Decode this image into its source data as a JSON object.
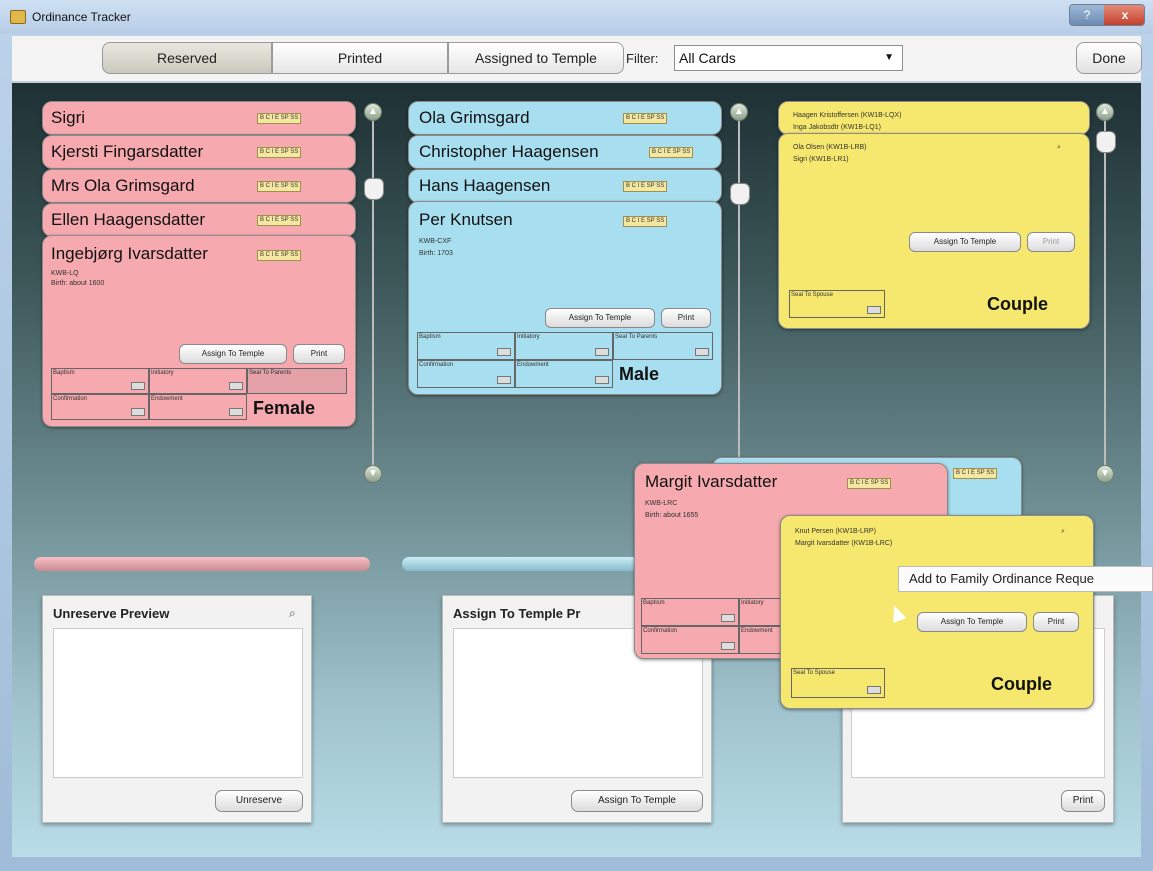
{
  "window": {
    "title": "Ordinance Tracker",
    "controls": [
      "?",
      "x"
    ]
  },
  "toolbar": {
    "tabs": [
      {
        "label": "Reserved",
        "active": true
      },
      {
        "label": "Printed",
        "active": false
      },
      {
        "label": "Assigned to Temple",
        "active": false
      }
    ],
    "filter_label": "Filter:",
    "filter_value": "All Cards",
    "done_label": "Done"
  },
  "ordinance_badge": "B C I E SP SS",
  "labels": {
    "assign_to_temple": "Assign To Temple",
    "print": "Print",
    "baptism": "Baptism",
    "initiatory": "Initiatory",
    "seal_to_parents": "Seal To Parents",
    "confirmation": "Confirmation",
    "endowment": "Endowment",
    "seal_to_spouse": "Seal To Spouse"
  },
  "stack_pink": {
    "names": [
      "Sigri",
      "Kjersti Fingarsdatter",
      "Mrs Ola Grimsgard",
      "Ellen Haagensdatter",
      "Ingebjørg Ivarsdatter"
    ],
    "id": "KWB-LQ",
    "birth": "Birth: about 1600",
    "gender": "Female"
  },
  "stack_blue": {
    "names": [
      "Ola Grimsgard",
      "Christopher Haagensen",
      "Hans Haagensen",
      "Per Knutsen"
    ],
    "id": "KWB-CXF",
    "birth": "Birth: 1703",
    "gender": "Male"
  },
  "stack_yellow": {
    "back_line1": "Haagen Kristoffersen (KW1B-LQX)",
    "back_line2": "Inga Jakobsdtr (KW1B-LQ1)",
    "line1": "Ola Olsen (KW1B-LRB)",
    "line2": "Sigri (KW1B-LR1)",
    "label": "Couple"
  },
  "floating_pink": {
    "name": "Margit Ivarsdatter",
    "id": "KWB-LRC",
    "birth": "Birth: about 1655"
  },
  "floating_yellow": {
    "line1": "Knut Persen (KW1B-LRP)",
    "line2": "Margit Ivarsdatter (KW1B-LRC)",
    "label": "Couple"
  },
  "tooltip": "Add to Family Ordinance Reque",
  "panels": {
    "unreserve": {
      "title": "Unreserve Preview",
      "button": "Unreserve"
    },
    "assign": {
      "title": "Assign To Temple Pr",
      "button": "Assign To Temple"
    },
    "print": {
      "button": "Print"
    }
  },
  "colors": {
    "pink": "#f6a9ae",
    "blue": "#a8dff0",
    "yellow": "#f6e86e"
  }
}
